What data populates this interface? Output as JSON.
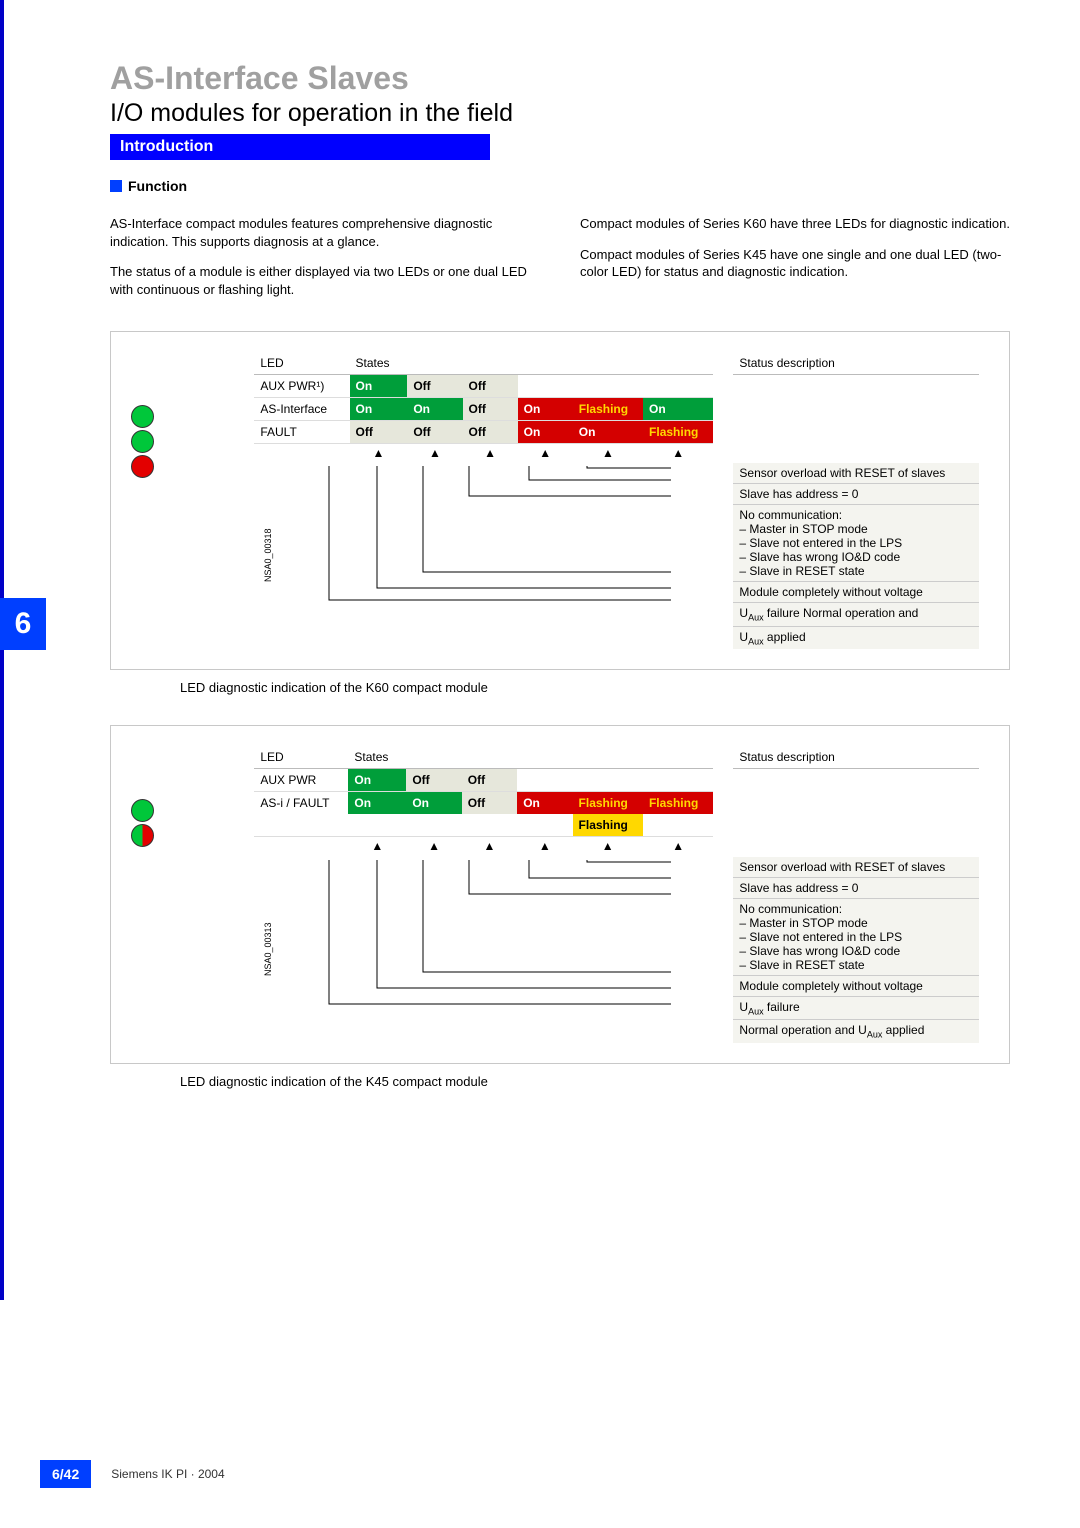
{
  "header": {
    "title": "AS-Interface Slaves",
    "subtitle": "I/O modules for operation in the field",
    "intro_label": "Introduction",
    "function_label": "Function"
  },
  "paragraphs": {
    "left1": "AS-Interface compact modules features comprehensive diagnostic indication. This supports diagnosis at a glance.",
    "left2": "The status of a module is either displayed via two LEDs or one dual LED with continuous or flashing light.",
    "right1": "Compact modules of Series K60 have three LEDs for diagnostic indication.",
    "right2": "Compact modules of Series K45 have one single and one dual LED (two-color LED) for status and diagnostic indication."
  },
  "chart_data": [
    {
      "type": "table",
      "id": "k60",
      "ref": "NSA0_00318",
      "caption": "LED diagnostic indication of the K60 compact module",
      "col_led": "LED",
      "col_states": "States",
      "col_status": "Status description",
      "leds": [
        {
          "name": "AUX PWR¹)",
          "color": "green",
          "states": [
            "On",
            "Off",
            "Off",
            "",
            "",
            ""
          ]
        },
        {
          "name": "AS-Interface",
          "color": "green",
          "states": [
            "On",
            "On",
            "Off",
            "On",
            "Flashing",
            "On"
          ],
          "style": [
            "on",
            "on",
            "off",
            "redon",
            "flashred",
            "on"
          ]
        },
        {
          "name": "FAULT",
          "color": "red",
          "states": [
            "Off",
            "Off",
            "Off",
            "On",
            "On",
            "Flashing"
          ],
          "style": [
            "off",
            "off",
            "off",
            "redon",
            "redon",
            "flashred"
          ]
        }
      ],
      "descriptions": [
        "Sensor overload with RESET of slaves",
        "Slave has address = 0",
        "No communication:\n– Master in STOP mode\n– Slave not entered in the LPS\n– Slave has wrong IO&D code\n– Slave in RESET state",
        "Module completely without voltage",
        "UAux failure Normal operation and",
        "UAux applied"
      ]
    },
    {
      "type": "table",
      "id": "k45",
      "ref": "NSA0_00313",
      "caption": "LED diagnostic indication of the K45 compact module",
      "col_led": "LED",
      "col_states": "States",
      "col_status": "Status description",
      "leds": [
        {
          "name": "AUX PWR",
          "color": "green",
          "states": [
            "On",
            "Off",
            "Off",
            "",
            "",
            ""
          ]
        },
        {
          "name": "AS-i / FAULT",
          "color": "dual",
          "states": [
            "On",
            "On",
            "Off",
            "On",
            "Flashing",
            "Flashing"
          ],
          "row2_yellow": "Flashing",
          "style": [
            "on",
            "on",
            "off",
            "redon",
            "flashred",
            "flashred"
          ]
        }
      ],
      "descriptions": [
        "Sensor overload with RESET of slaves",
        "Slave has address = 0",
        "No communication:\n– Master in STOP mode\n– Slave not entered in the LPS\n– Slave has wrong IO&D code\n– Slave in RESET state",
        "Module completely without voltage",
        "UAux failure",
        "Normal operation and UAux applied"
      ]
    }
  ],
  "side_tab": "6",
  "footer": {
    "page": "6/42",
    "publisher": "Siemens IK PI · 2004"
  }
}
